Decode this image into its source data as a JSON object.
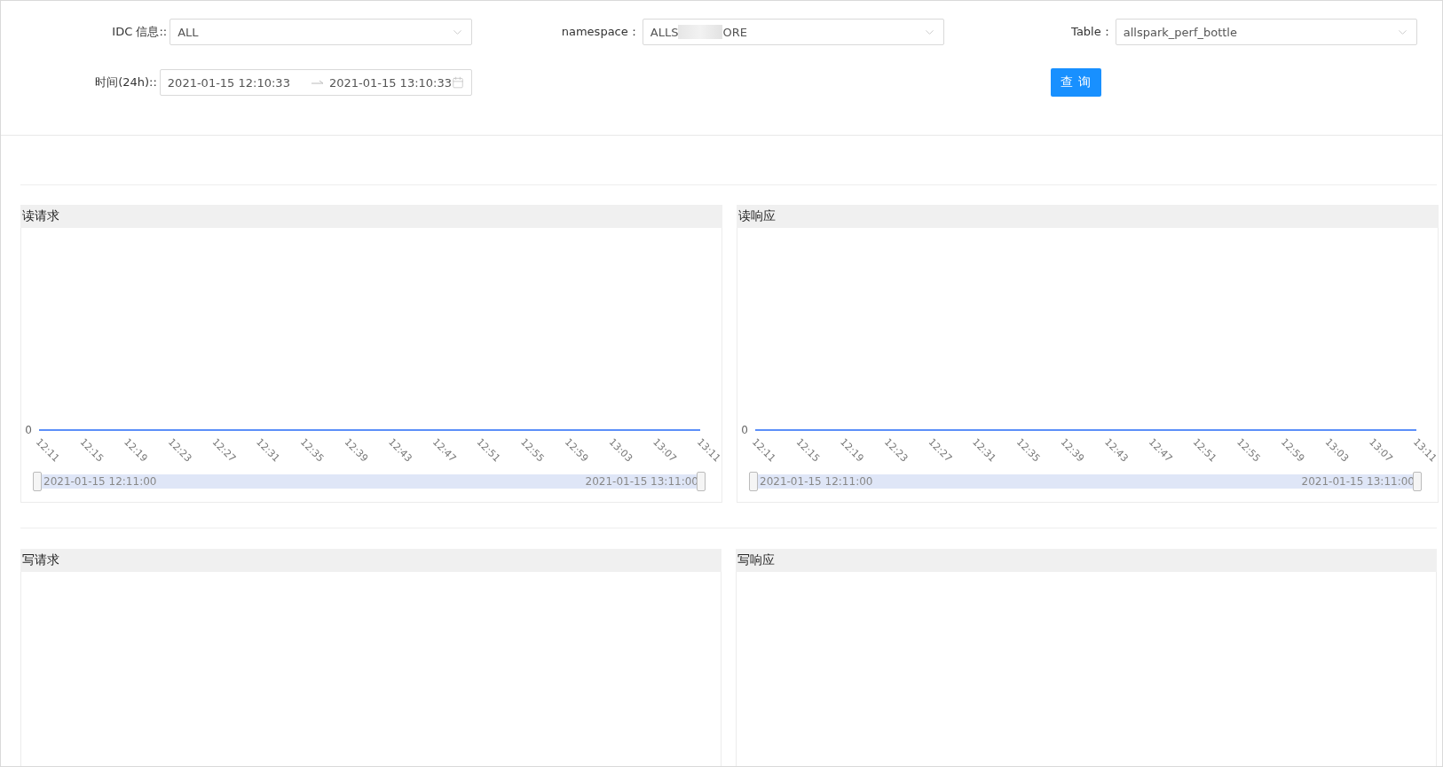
{
  "filters": {
    "idc": {
      "label": "IDC 信息::",
      "value": "ALL"
    },
    "namespace": {
      "label": "namespace：",
      "value_parts": [
        "ALLS",
        "ORE"
      ]
    },
    "table": {
      "label": "Table：",
      "value": "allspark_perf_bottle"
    },
    "time": {
      "label": "时间(24h)::",
      "start": "2021-01-15 12:10:33",
      "end": "2021-01-15 13:10:33"
    },
    "query_button": "查 询"
  },
  "panels": [
    {
      "title": "读请求",
      "chart": {
        "y_axis_label": "0",
        "x_axis_labels": [
          "12:11",
          "12:15",
          "12:19",
          "12:23",
          "12:27",
          "12:31",
          "12:35",
          "12:39",
          "12:43",
          "12:47",
          "12:51",
          "12:55",
          "12:59",
          "13:03",
          "13:07",
          "13:11"
        ]
      },
      "slider": {
        "level": 1,
        "start": "2021-01-15 12:11:00",
        "end": "2021-01-15 13:11:00"
      }
    },
    {
      "title": "读响应",
      "chart": {
        "y_axis_label": "0",
        "x_axis_labels": [
          "12:11",
          "12:15",
          "12:19",
          "12:23",
          "12:27",
          "12:31",
          "12:35",
          "12:39",
          "12:43",
          "12:47",
          "12:51",
          "12:55",
          "12:59",
          "13:03",
          "13:07",
          "13:11"
        ]
      },
      "slider": {
        "level": 1,
        "start": "2021-01-15 12:11:00",
        "end": "2021-01-15 13:11:00"
      }
    },
    {
      "title": "写请求"
    },
    {
      "title": "写响应"
    }
  ]
}
